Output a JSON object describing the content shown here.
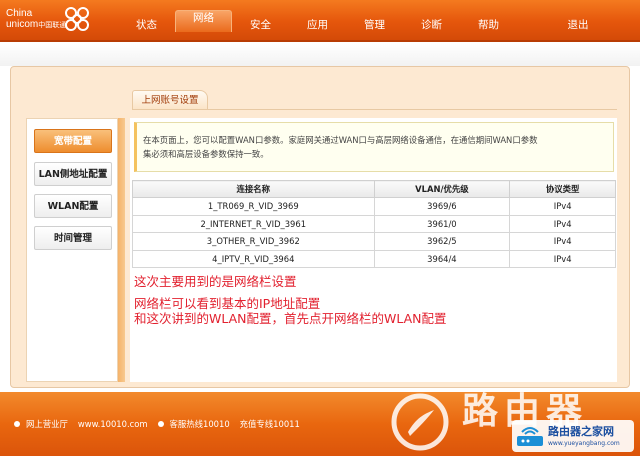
{
  "header": {
    "logo_line1": "China",
    "logo_line2": "unicom",
    "logo_cn": "中国联通",
    "nav": [
      "状态",
      "网络",
      "安全",
      "应用",
      "管理",
      "诊断",
      "帮助"
    ],
    "active_nav": "网络",
    "logout": "退出"
  },
  "section": {
    "title": "上网账号设置"
  },
  "sidebar": {
    "items": [
      {
        "label": "宽带配置",
        "active": true
      },
      {
        "label": "LAN侧地址配置",
        "active": false
      },
      {
        "label": "WLAN配置",
        "active": false
      },
      {
        "label": "时间管理",
        "active": false
      }
    ]
  },
  "info": {
    "line1": "在本页面上，您可以配置WAN口参数。家庭网关通过WAN口与高层网络设备通信，在通信期间WAN口参数",
    "line2": "集必须和高层设备参数保持一致。"
  },
  "table": {
    "headers": [
      "连接名称",
      "VLAN/优先级",
      "协议类型"
    ],
    "rows": [
      [
        "1_TR069_R_VID_3969",
        "3969/6",
        "IPv4"
      ],
      [
        "2_INTERNET_R_VID_3961",
        "3961/0",
        "IPv4"
      ],
      [
        "3_OTHER_R_VID_3962",
        "3962/5",
        "IPv4"
      ],
      [
        "4_IPTV_R_VID_3964",
        "3964/4",
        "IPv4"
      ]
    ]
  },
  "notes": {
    "line1": "这次主要用到的是网络栏设置",
    "line2": "网络栏可以看到基本的IP地址配置",
    "line3": "和这次讲到的WLAN配置，首先点开网络栏的WLAN配置"
  },
  "footer": {
    "link1": "网上营业厅",
    "link1_url": "www.10010.com",
    "link2": "客服热线10010",
    "link3": "充值专线10011"
  },
  "watermark": {
    "big_text": "路由器",
    "badge_title": "路由器之家网",
    "badge_url": "www.yueyangbang.com"
  },
  "colors": {
    "header_orange": "#e5560c",
    "accent_red": "#e2212f",
    "active_menu": "#ee8d2e"
  }
}
